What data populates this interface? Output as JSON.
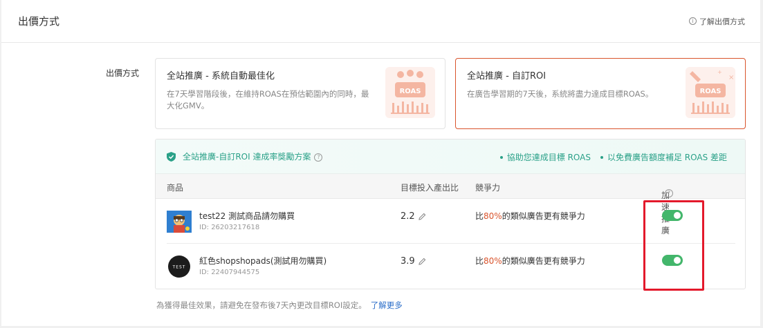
{
  "header": {
    "title": "出價方式",
    "help_link": "了解出價方式",
    "info_glyph": "i"
  },
  "bidding": {
    "row_label": "出價方式",
    "options": [
      {
        "title": "全站推廣 - 系統自動最佳化",
        "desc": "在7天學習階段後，在維持ROAS在預估範圍內的同時，最大化GMV。",
        "art_label": "ROAS",
        "selected": false
      },
      {
        "title": "全站推廣 - 自訂ROI",
        "desc": "在廣告學習期的7天後，系統將盡力達成目標ROAS。",
        "art_label": "ROAS",
        "selected": true
      }
    ]
  },
  "banner": {
    "title": "全站推廣-自訂ROI 達成率獎勵方案",
    "help_glyph": "?",
    "benefits": [
      "協助您達成目標 ROAS",
      "以免費廣告額度補足 ROAS 差距"
    ]
  },
  "table": {
    "columns": {
      "product": "商品",
      "roi": "目標投入產出比",
      "competitiveness": "競爭力",
      "boost": "加速推廣"
    },
    "boost_help_glyph": "?",
    "rows": [
      {
        "name": "test22 測試商品請勿購買",
        "id": "ID: 26203217618",
        "roi": "2.2",
        "comp_prefix": "比",
        "comp_pct": "80%",
        "comp_suffix": "的類似廣告更有競爭力",
        "boost_on": true
      },
      {
        "name": "紅色shopshopads(測試用勿購買)",
        "id": "ID: 22407944575",
        "roi": "3.9",
        "comp_prefix": "比",
        "comp_pct": "80%",
        "comp_suffix": "的類似廣告更有競爭力",
        "logo_text": "TEST",
        "boost_on": true
      }
    ]
  },
  "footer": {
    "note": "為獲得最佳效果，請避免在發布後7天內更改目標ROI設定。",
    "link": "了解更多"
  },
  "colors": {
    "accent": "#d9532b",
    "teal": "#2aa188",
    "toggle_on": "#43b66b",
    "highlight_box": "#e3192b",
    "link": "#2b6ec9"
  },
  "icons": [
    "info-icon",
    "shield-check-icon",
    "help-icon",
    "pencil-icon",
    "roas-illustration",
    "product-thumbnail"
  ]
}
